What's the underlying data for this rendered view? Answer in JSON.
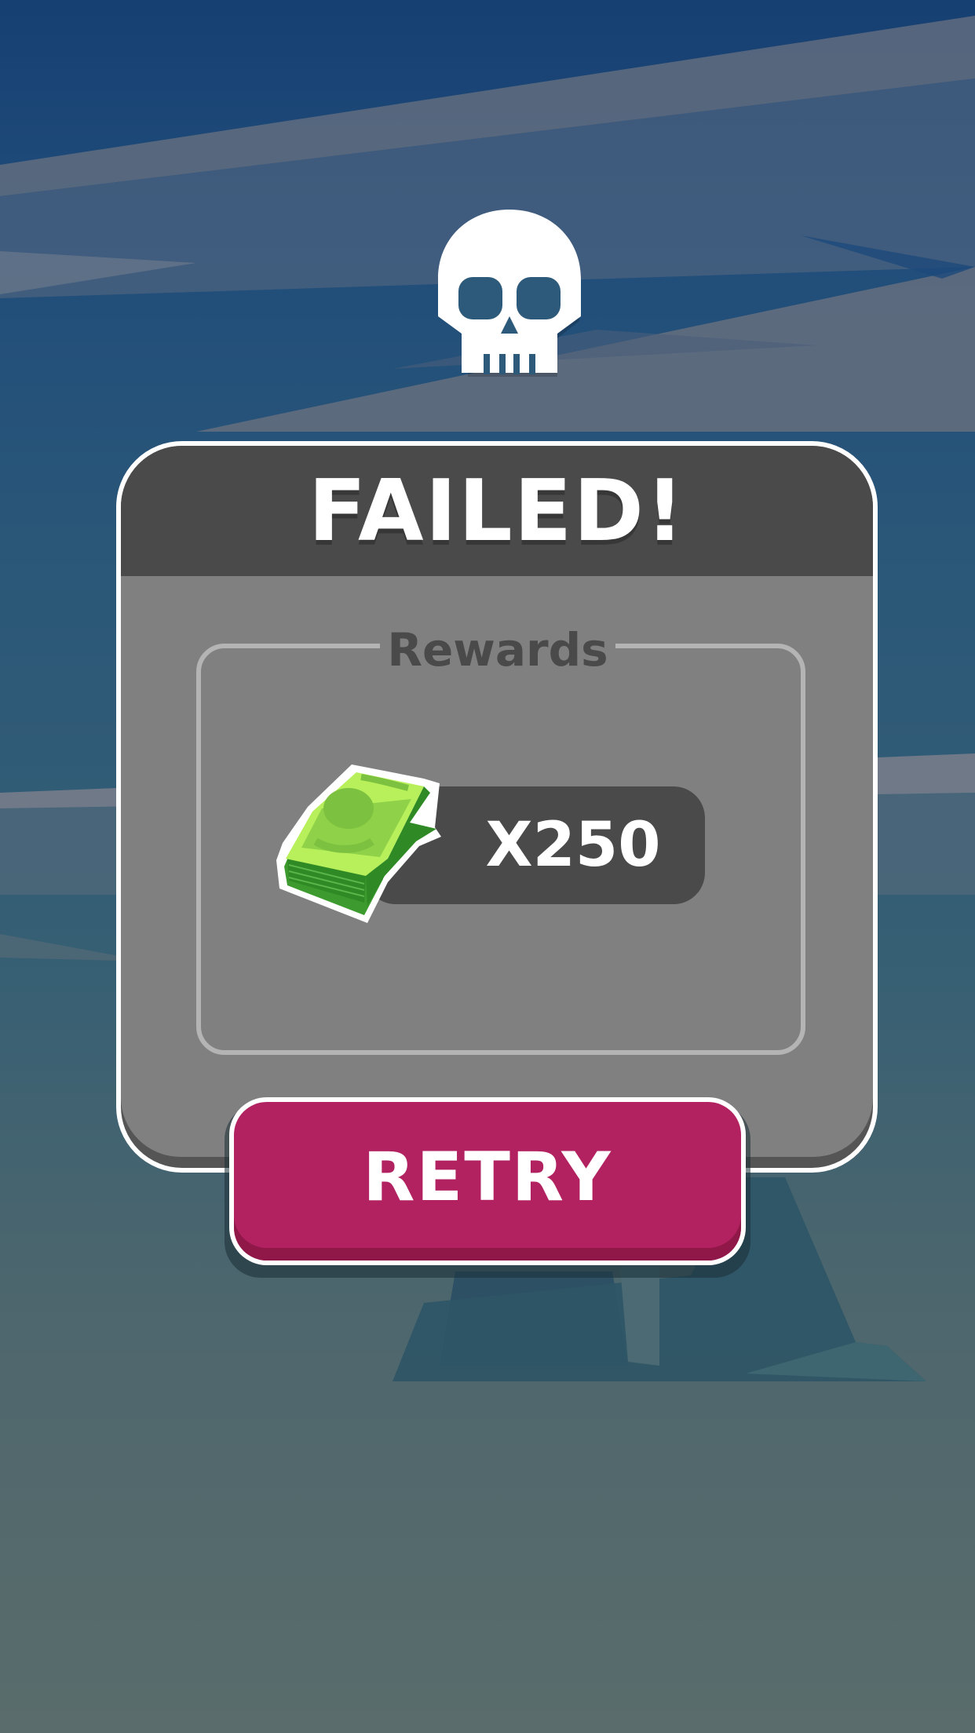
{
  "result": {
    "title": "FAILED!",
    "status_icon": "skull-icon"
  },
  "rewards": {
    "label": "Rewards",
    "item_icon": "cash-stack-icon",
    "amount": "X250"
  },
  "actions": {
    "retry_label": "RETRY"
  },
  "colors": {
    "header": "#4a4a4a",
    "panel": "#808080",
    "retry_button": "#b22160",
    "cash_green": "#8fd24a"
  }
}
